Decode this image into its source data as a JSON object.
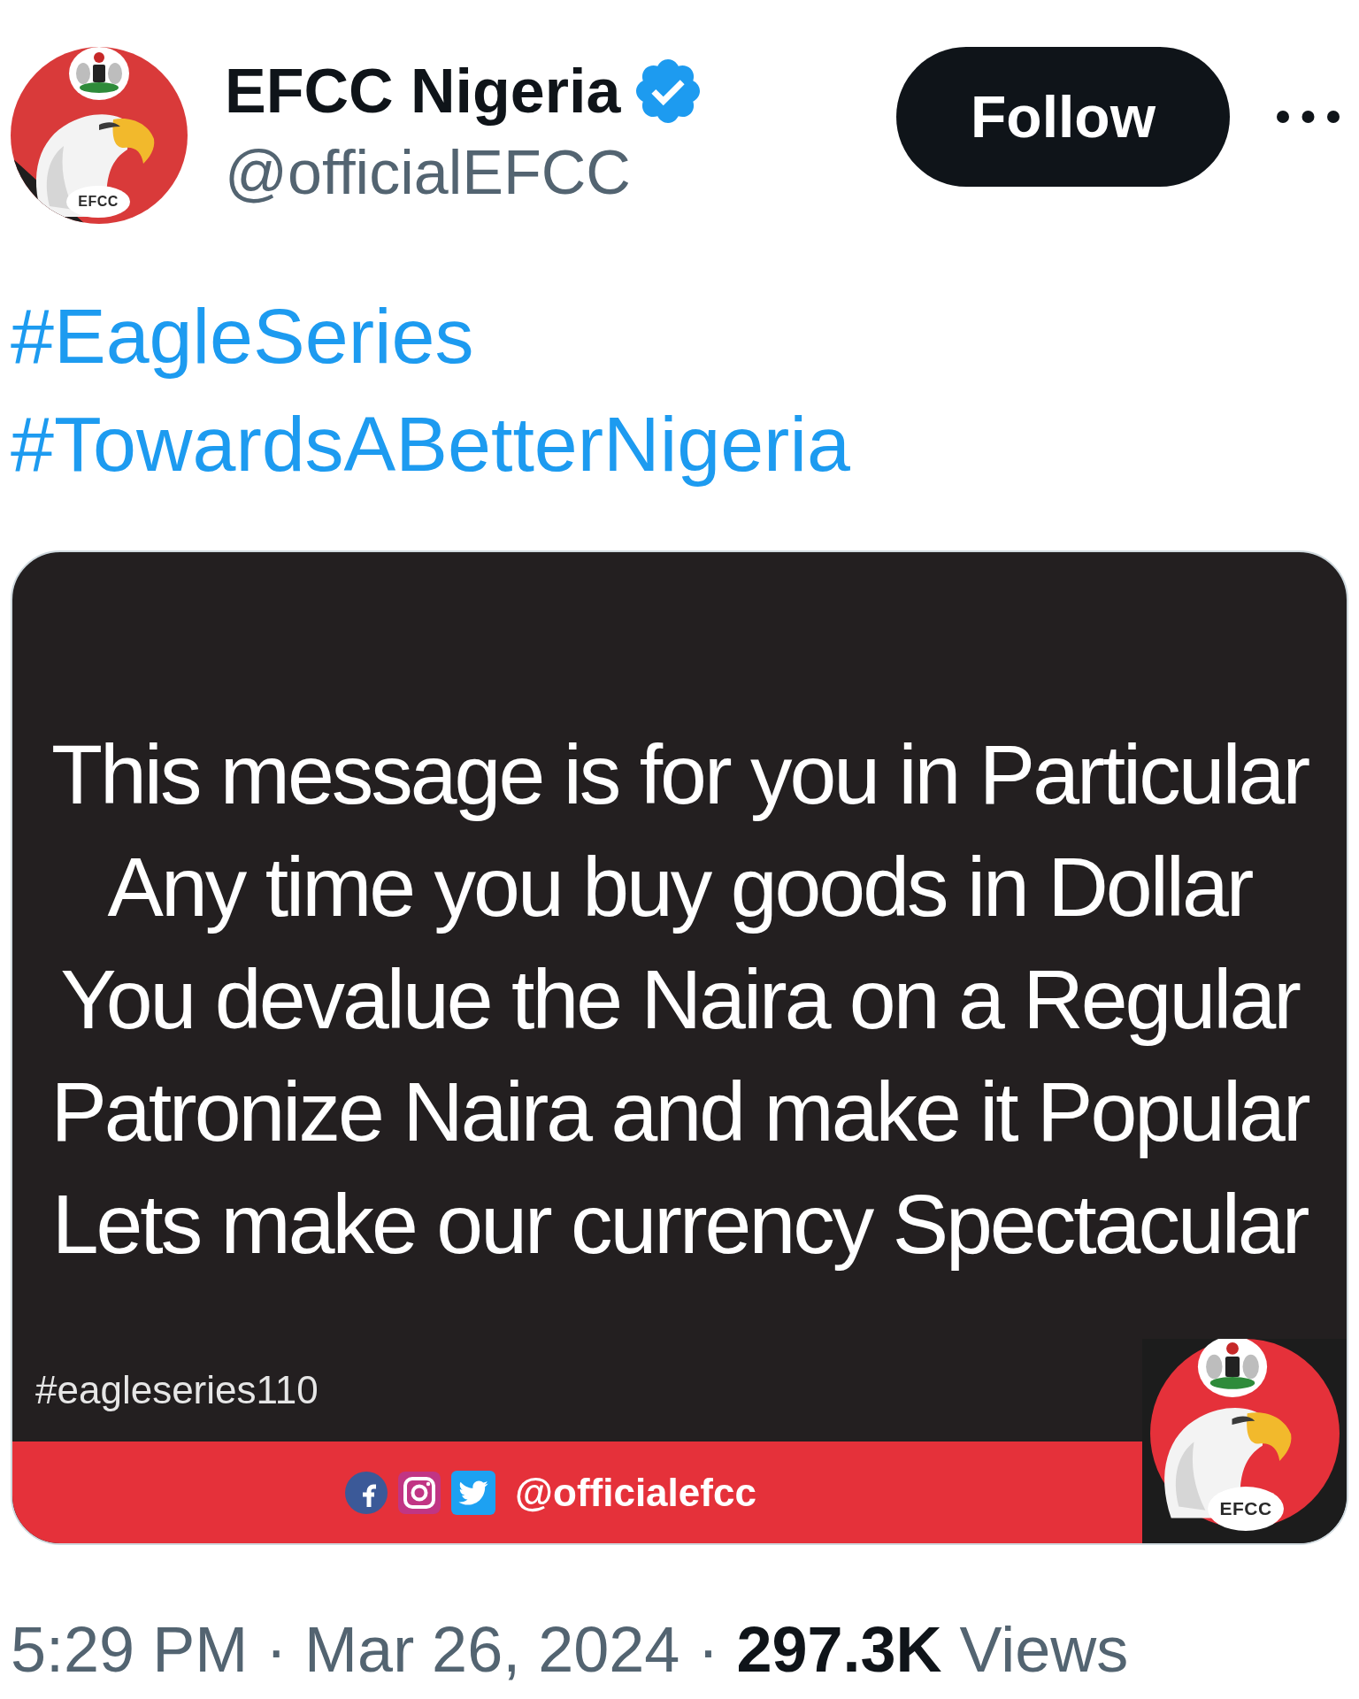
{
  "author": {
    "avatar_label": "EFCC",
    "name": "EFCC Nigeria",
    "verified": true,
    "handle": "@officialEFCC"
  },
  "follow_button": {
    "label": "Follow"
  },
  "hashtags": [
    "#EagleSeries",
    "#TowardsABetterNigeria"
  ],
  "media": {
    "lines": [
      "This message is for you in Particular",
      "Any time you buy goods in Dollar",
      "You devalue the Naira on a Regular",
      "Patronize Naira and make it Popular",
      "Lets make our currency Spectacular"
    ],
    "hashtag": "#eagleseries110",
    "social_handle": "@officialefcc",
    "logo_label": "EFCC"
  },
  "meta": "5:29 PM · Mar 26, 2024 · **297.3K** Views"
}
